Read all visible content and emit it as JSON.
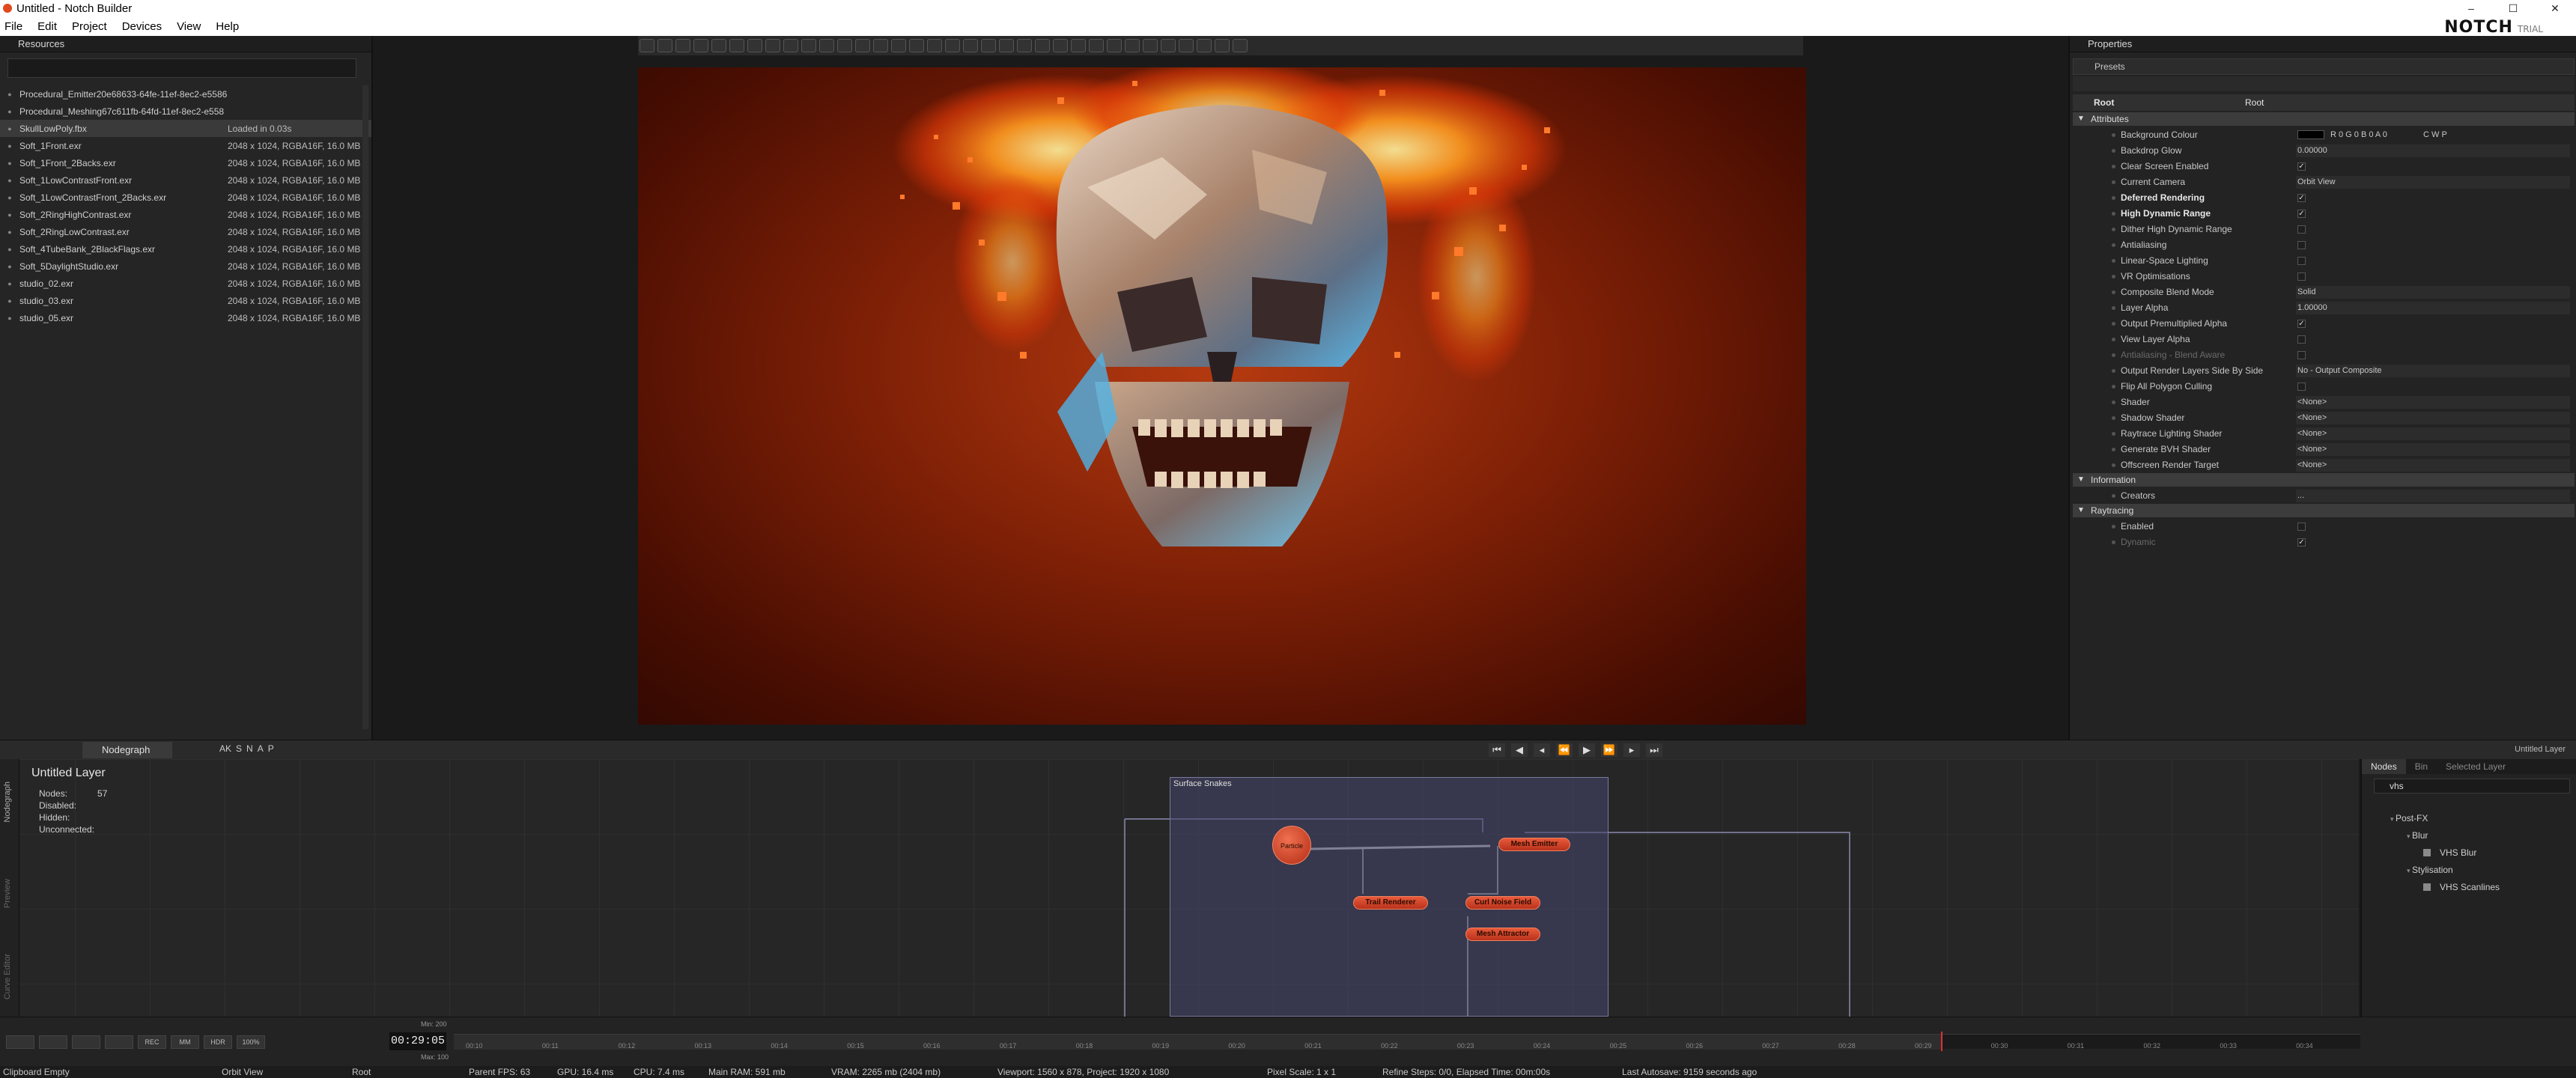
{
  "window": {
    "title": "Untitled - Notch Builder",
    "minimize": "–",
    "maximize": "☐",
    "close": "✕"
  },
  "menu": [
    "File",
    "Edit",
    "Project",
    "Devices",
    "View",
    "Help"
  ],
  "brand": {
    "logo": "NOTCH",
    "edition": "TRIAL"
  },
  "resources": {
    "title": "Resources",
    "items": [
      {
        "name": "Procedural_Emitter20e68633-64fe-11ef-8ec2-e5586",
        "info": ""
      },
      {
        "name": "Procedural_Meshing67c611fb-64fd-11ef-8ec2-e558",
        "info": ""
      },
      {
        "name": "SkullLowPoly.fbx",
        "info": "Loaded in 0.03s",
        "selected": true
      },
      {
        "name": "Soft_1Front.exr",
        "info": "2048 x 1024, RGBA16F, 16.0 MB"
      },
      {
        "name": "Soft_1Front_2Backs.exr",
        "info": "2048 x 1024, RGBA16F, 16.0 MB"
      },
      {
        "name": "Soft_1LowContrastFront.exr",
        "info": "2048 x 1024, RGBA16F, 16.0 MB"
      },
      {
        "name": "Soft_1LowContrastFront_2Backs.exr",
        "info": "2048 x 1024, RGBA16F, 16.0 MB"
      },
      {
        "name": "Soft_2RingHighContrast.exr",
        "info": "2048 x 1024, RGBA16F, 16.0 MB"
      },
      {
        "name": "Soft_2RingLowContrast.exr",
        "info": "2048 x 1024, RGBA16F, 16.0 MB"
      },
      {
        "name": "Soft_4TubeBank_2BlackFlags.exr",
        "info": "2048 x 1024, RGBA16F, 16.0 MB"
      },
      {
        "name": "Soft_5DaylightStudio.exr",
        "info": "2048 x 1024, RGBA16F, 16.0 MB"
      },
      {
        "name": "studio_02.exr",
        "info": "2048 x 1024, RGBA16F, 16.0 MB"
      },
      {
        "name": "studio_03.exr",
        "info": "2048 x 1024, RGBA16F, 16.0 MB"
      },
      {
        "name": "studio_05.exr",
        "info": "2048 x 1024, RGBA16F, 16.0 MB"
      }
    ]
  },
  "properties": {
    "title": "Properties",
    "presets": "Presets",
    "root_name": "Root",
    "root_value": "Root",
    "sections": {
      "attributes": "Attributes",
      "information": "Information",
      "raytracing": "Raytracing"
    },
    "background_colour_value": "R 0  G 0  B 0  A 0",
    "background_colour_modes": "C   W   P",
    "rows": [
      {
        "label": "Background Colour",
        "type": "color"
      },
      {
        "label": "Backdrop Glow",
        "type": "value",
        "value": "0.00000"
      },
      {
        "label": "Clear Screen Enabled",
        "type": "check",
        "checked": true
      },
      {
        "label": "Current Camera",
        "type": "value",
        "value": "Orbit View"
      },
      {
        "label": "Deferred Rendering",
        "type": "check",
        "checked": true,
        "bold": true
      },
      {
        "label": "High Dynamic Range",
        "type": "check",
        "checked": true,
        "bold": true
      },
      {
        "label": "Dither High Dynamic Range",
        "type": "check",
        "checked": false
      },
      {
        "label": "Antialiasing",
        "type": "check",
        "checked": false
      },
      {
        "label": "Linear-Space Lighting",
        "type": "check",
        "checked": false
      },
      {
        "label": "VR Optimisations",
        "type": "check",
        "checked": false
      },
      {
        "label": "Composite Blend Mode",
        "type": "value",
        "value": "Solid"
      },
      {
        "label": "Layer Alpha",
        "type": "value",
        "value": "1.00000"
      },
      {
        "label": "Output Premultiplied Alpha",
        "type": "check",
        "checked": true
      },
      {
        "label": "View Layer Alpha",
        "type": "check",
        "checked": false
      },
      {
        "label": "Antialiasing - Blend Aware",
        "type": "check",
        "checked": false,
        "dim": true
      },
      {
        "label": "Output Render Layers Side By Side",
        "type": "value",
        "value": "No - Output Composite"
      },
      {
        "label": "Flip All Polygon Culling",
        "type": "check",
        "checked": false
      },
      {
        "label": "Shader",
        "type": "value",
        "value": "<None>"
      },
      {
        "label": "Shadow Shader",
        "type": "value",
        "value": "<None>"
      },
      {
        "label": "Raytrace Lighting Shader",
        "type": "value",
        "value": "<None>"
      },
      {
        "label": "Generate BVH Shader",
        "type": "value",
        "value": "<None>"
      },
      {
        "label": "Offscreen Render Target",
        "type": "value",
        "value": "<None>"
      }
    ],
    "info_rows": [
      {
        "label": "Creators",
        "type": "value",
        "value": "..."
      }
    ],
    "ray_rows": [
      {
        "label": "Enabled",
        "type": "check",
        "checked": false
      },
      {
        "label": "Dynamic",
        "type": "check",
        "checked": true,
        "dim": true
      }
    ]
  },
  "nodegraph": {
    "tab": "Nodegraph",
    "toolbar_letters": [
      "AK",
      "S",
      "N",
      "A",
      "P"
    ],
    "layer_title": "Untitled  Layer",
    "stats": [
      {
        "label": "Nodes:",
        "value": "57"
      },
      {
        "label": "Disabled:",
        "value": ""
      },
      {
        "label": "Hidden:",
        "value": ""
      },
      {
        "label": "Unconnected:",
        "value": ""
      }
    ],
    "group_label": "Surface Snakes",
    "nodes": {
      "particle": "Particle",
      "mesh_emitter": "Mesh Emitter",
      "trail_renderer": "Trail Renderer",
      "curl_noise_field": "Curl Noise Field",
      "mesh_attractor": "Mesh Attractor"
    },
    "side_tabs": [
      "Nodegraph",
      "Preview",
      "Curve Editor"
    ]
  },
  "layer_indicator": "Untitled Layer",
  "nodes_panel": {
    "tabs": [
      "Nodes",
      "Bin",
      "Selected Layer"
    ],
    "search": "vhs",
    "tree": [
      {
        "label": "Post-FX",
        "level": 0
      },
      {
        "label": "Blur",
        "level": 1
      },
      {
        "label": "VHS Blur",
        "level": 2,
        "leaf": true
      },
      {
        "label": "Stylisation",
        "level": 1
      },
      {
        "label": "VHS Scanlines",
        "level": 2,
        "leaf": true
      }
    ]
  },
  "timeline": {
    "timecode": "00:29:05",
    "min_label": "Min: 200",
    "max_label": "Max: 100",
    "buttons": [
      "",
      "",
      "",
      "",
      "REC",
      "MM",
      "HDR",
      "100%"
    ],
    "ticks": [
      "00:10",
      "00:11",
      "00:12",
      "00:13",
      "00:14",
      "00:15",
      "00:16",
      "00:17",
      "00:18",
      "00:19",
      "00:20",
      "00:21",
      "00:22",
      "00:23",
      "00:24",
      "00:25",
      "00:26",
      "00:27",
      "00:28",
      "00:29",
      "00:30",
      "00:31",
      "00:32",
      "00:33",
      "00:34"
    ],
    "progress": 0.78
  },
  "status": {
    "clipboard": "Clipboard Empty",
    "camera": "Orbit View",
    "root": "Root",
    "fps": "Parent FPS: 63",
    "gpu": "GPU: 16.4 ms",
    "cpu": "CPU: 7.4 ms",
    "ram": "Main RAM: 591 mb",
    "vram": "VRAM: 2265 mb (2404 mb)",
    "viewport": "Viewport: 1560 x 878, Project: 1920 x 1080",
    "pixel_scale": "Pixel Scale: 1 x 1",
    "raysteps": "Refine Steps: 0/0, Elapsed Time: 00m:00s",
    "autosave": "Last Autosave: 9159 seconds ago"
  }
}
